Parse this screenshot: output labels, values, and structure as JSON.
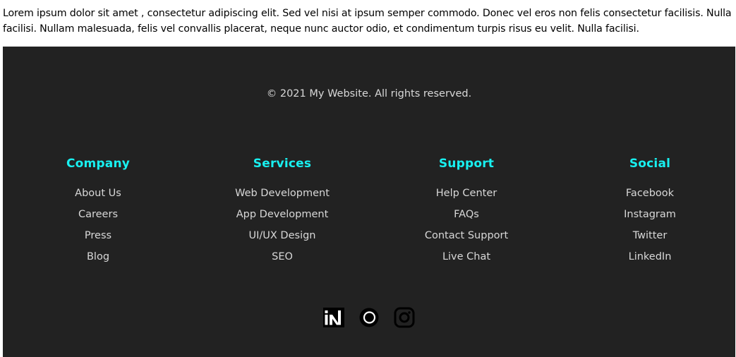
{
  "intro": {
    "text": "Lorem ipsum dolor sit amet , consectetur adipiscing elit. Sed vel nisi at ipsum semper commodo. Donec vel eros non felis consectetur facilisis. Nulla facilisi. Nullam malesuada, felis vel convallis placerat, neque nunc auctor odio, et condimentum turpis risus eu velit. Nulla facilisi."
  },
  "footer": {
    "copyright": "© 2021 My Website. All rights reserved.",
    "columns": [
      {
        "heading": "Company",
        "links": [
          "About Us",
          "Careers",
          "Press",
          "Blog"
        ]
      },
      {
        "heading": "Services",
        "links": [
          "Web Development",
          "App Development",
          "UI/UX Design",
          "SEO"
        ]
      },
      {
        "heading": "Support",
        "links": [
          "Help Center",
          "FAQs",
          "Contact Support",
          "Live Chat"
        ]
      },
      {
        "heading": "Social",
        "links": [
          "Facebook",
          "Instagram",
          "Twitter",
          "LinkedIn"
        ]
      }
    ],
    "social_icons": [
      "linkedin-icon",
      "circle-logo-icon",
      "instagram-icon"
    ]
  },
  "colors": {
    "footer_background": "#222222",
    "heading_accent": "#18f0f0",
    "footer_text": "#d8d8d8"
  }
}
